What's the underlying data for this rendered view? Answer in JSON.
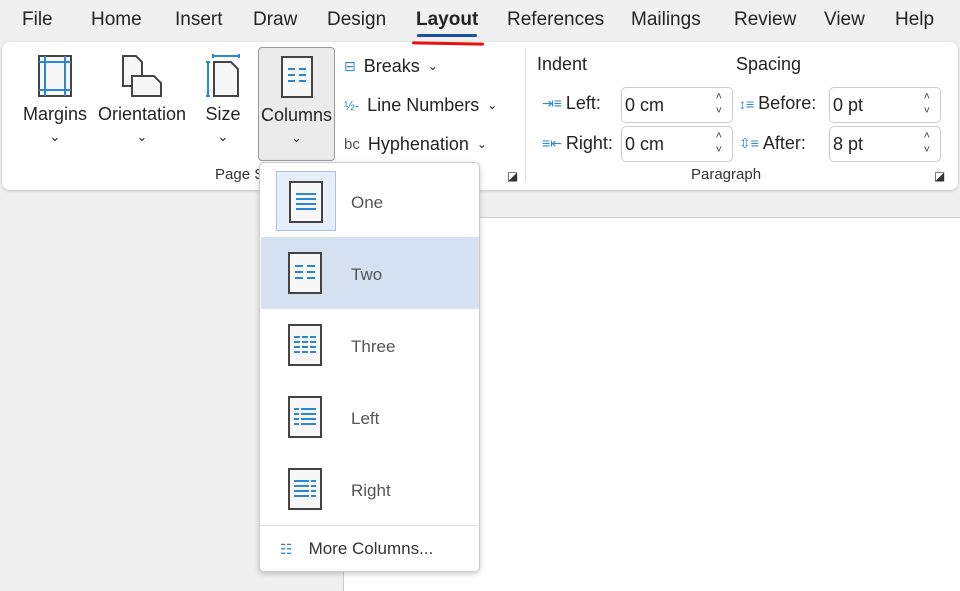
{
  "menu": {
    "tabs": [
      "File",
      "Home",
      "Insert",
      "Draw",
      "Design",
      "Layout",
      "References",
      "Mailings",
      "Review",
      "View",
      "Help"
    ],
    "active": "Layout"
  },
  "page_setup": {
    "margins": "Margins",
    "orientation": "Orientation",
    "size": "Size",
    "columns": "Columns",
    "breaks": "Breaks",
    "line_numbers": "Line Numbers",
    "hyphenation": "Hyphenation",
    "group_label": "Page Setup"
  },
  "paragraph": {
    "indent_title": "Indent",
    "spacing_title": "Spacing",
    "left_label": "Left:",
    "right_label": "Right:",
    "before_label": "Before:",
    "after_label": "After:",
    "left_value": "0 cm",
    "right_value": "0 cm",
    "before_value": "0 pt",
    "after_value": "8 pt",
    "group_label": "Paragraph"
  },
  "columns_menu": {
    "options": [
      "One",
      "Two",
      "Three",
      "Left",
      "Right"
    ],
    "selected": "One",
    "hovered": "Two",
    "more": "More Columns..."
  },
  "colors": {
    "accent": "#2b88d8",
    "hover": "#d5e0f1",
    "active_tab_underline": "#1b4fa8",
    "annotation": "#e81010"
  }
}
